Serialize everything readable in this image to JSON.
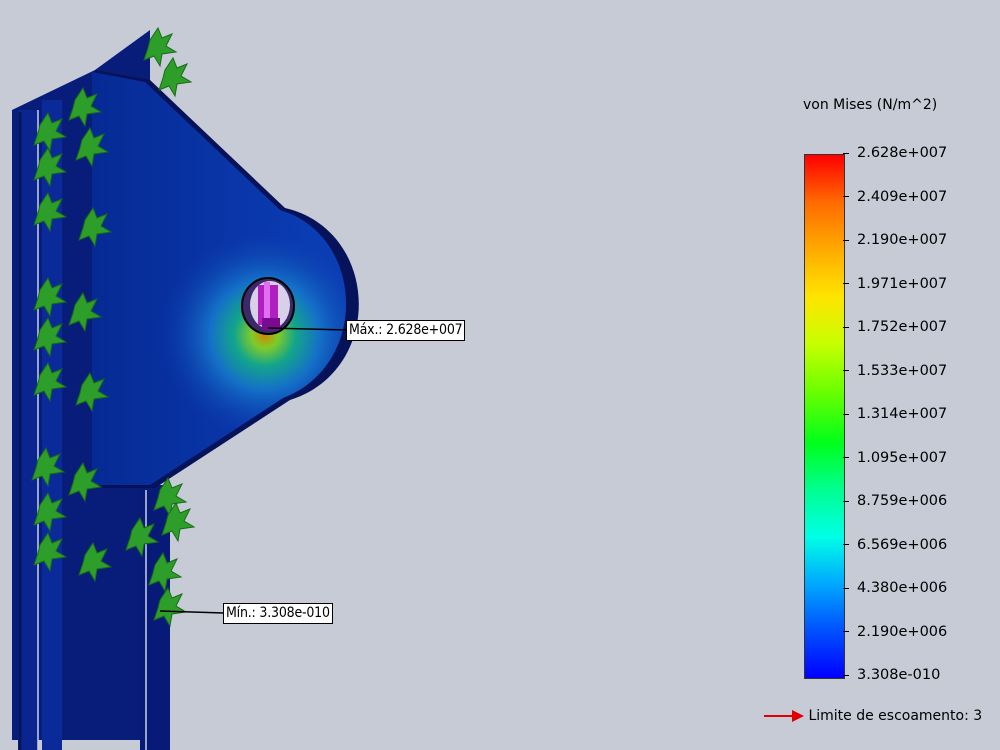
{
  "legend": {
    "title": "von Mises (N/m^2)",
    "ticks": [
      "2.628e+007",
      "2.409e+007",
      "2.190e+007",
      "1.971e+007",
      "1.752e+007",
      "1.533e+007",
      "1.314e+007",
      "1.095e+007",
      "8.759e+006",
      "6.569e+006",
      "4.380e+006",
      "2.190e+006",
      "3.308e-010"
    ],
    "yield_label": "Limite de escoamento: 3"
  },
  "callouts": {
    "max": "Máx.: 2.628e+007",
    "min": "Mín.: 3.308e-010"
  },
  "colors": {
    "background": "#c6cbd6",
    "part_blue": "#0a2c9e",
    "part_dark": "#06135a",
    "fixture_green": "#2e9e2a",
    "pin_magenta": "#b020c0",
    "yield_arrow": "#e00000"
  }
}
